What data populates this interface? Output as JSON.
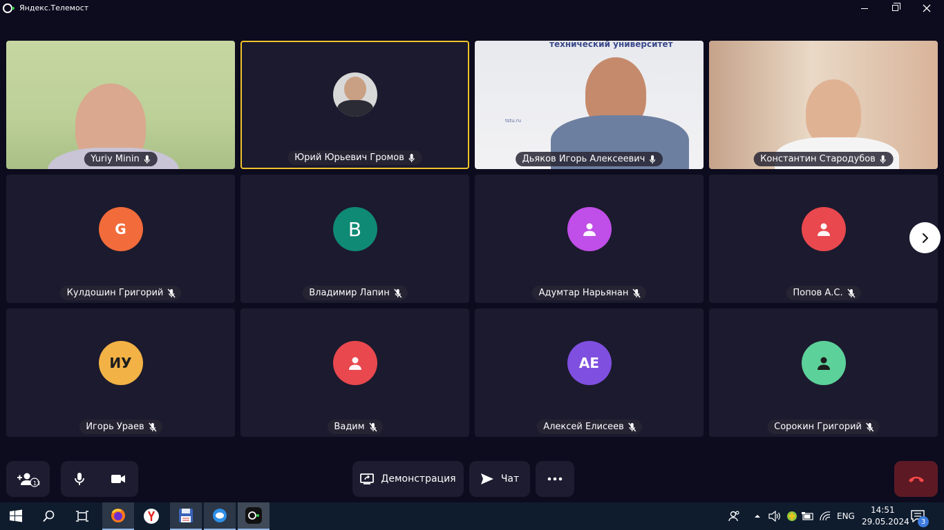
{
  "window": {
    "title": "Яндекс.Телемост"
  },
  "participants": [
    {
      "name": "Yuriy Minin",
      "mic": "on",
      "type": "video"
    },
    {
      "name": "Юрий  Юрьевич Громов",
      "mic": "on",
      "type": "photo",
      "active": true
    },
    {
      "name": "Дьяков Игорь Алексеевич",
      "mic": "on",
      "type": "video",
      "banner": "технический университет",
      "wall_text": "tstu.ru"
    },
    {
      "name": "Константин Стародубов",
      "mic": "on",
      "type": "video"
    },
    {
      "name": "Кулдошин Григорий",
      "mic": "off",
      "type": "avatar",
      "initials": "G",
      "color": "#f26b3a"
    },
    {
      "name": "Владимир Лапин",
      "mic": "off",
      "type": "avatar",
      "initials": "В",
      "color": "#0f8a74"
    },
    {
      "name": "Адумтар Нарьянан",
      "mic": "off",
      "type": "avatar",
      "icon": "user-icon",
      "color": "#c04ee8"
    },
    {
      "name": "Попов А.С.",
      "mic": "off",
      "type": "avatar",
      "icon": "user-icon",
      "color": "#e8484e"
    },
    {
      "name": "Игорь Ураев",
      "mic": "off",
      "type": "avatar",
      "initials": "ИУ",
      "color": "#f2b246"
    },
    {
      "name": "Вадим",
      "mic": "off",
      "type": "avatar",
      "icon": "user-icon",
      "color": "#e8484e"
    },
    {
      "name": "Алексей Елисеев",
      "mic": "off",
      "type": "avatar",
      "initials": "АЕ",
      "color": "#7f4fe0"
    },
    {
      "name": "Сорокин Григорий",
      "mic": "off",
      "type": "avatar",
      "icon": "user-icon",
      "color": "#5cd19a"
    }
  ],
  "controls": {
    "participants_count": "13",
    "demo_label": "Демонстрация",
    "chat_label": "Чат"
  },
  "taskbar": {
    "lang": "ENG",
    "time": "14:51",
    "date": "29.05.2024",
    "notifications": "3"
  }
}
